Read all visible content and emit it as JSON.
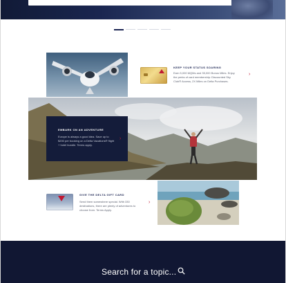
{
  "carousel": {
    "slide_count": 5,
    "active_index": 0
  },
  "status_promo": {
    "title": "KEEP YOUR STATUS SOARING",
    "body": "Earn 5,000 MQMs and 35,000 Bonus Miles. Enjoy the perks of card membership: Discounted Sky Club® Access, 2X Miles on Delta Purchases.",
    "card_image": "delta-reserve-card",
    "chevron": "›"
  },
  "adventure_promo": {
    "title": "EMBARK ON AN ADVENTURE",
    "body": "Europe is always a good idea. Save up to $200 per booking on a Delta Vacations® flight + hotel bundle. Terms apply.",
    "chevron": "›"
  },
  "gift_promo": {
    "title": "GIVE THE DELTA GIFT CARD",
    "body": "Send them somewhere special. With 330 destinations, there are plenty of adventures to choose from. Terms Apply.",
    "card_image": "delta-gift-card",
    "chevron": "›"
  },
  "footer": {
    "search_label": "Search for a topic...",
    "search_icon": "search-icon"
  },
  "colors": {
    "navy": "#111733",
    "brand_red": "#c01933",
    "dot_active": "#1b2452",
    "dot_inactive": "#d5d8e0"
  }
}
